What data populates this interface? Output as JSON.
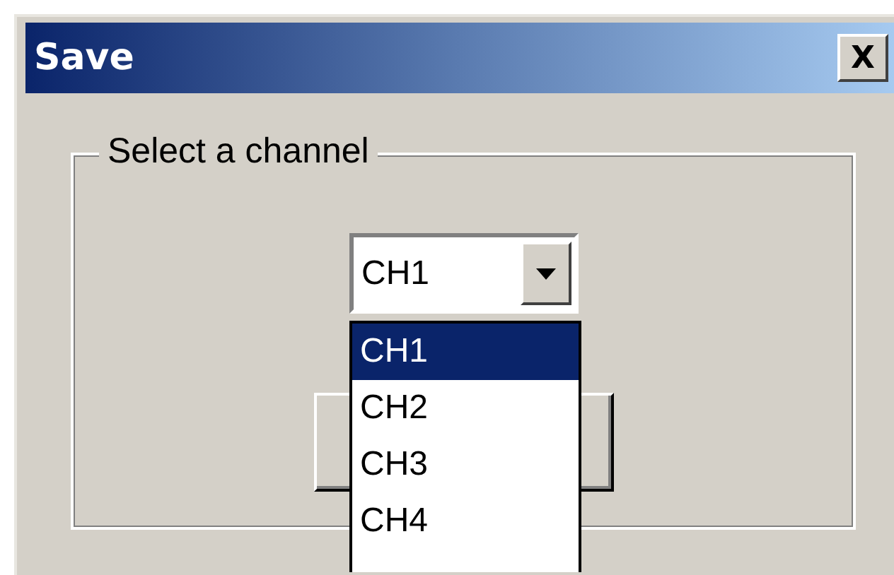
{
  "window": {
    "title": "Save",
    "close_label": "X"
  },
  "group": {
    "label": "Select a channel"
  },
  "combo": {
    "value": "CH1",
    "expanded": true,
    "options": [
      {
        "label": "CH1",
        "selected": true
      },
      {
        "label": "CH2",
        "selected": false
      },
      {
        "label": "CH3",
        "selected": false
      },
      {
        "label": "CH4",
        "selected": false
      }
    ]
  }
}
